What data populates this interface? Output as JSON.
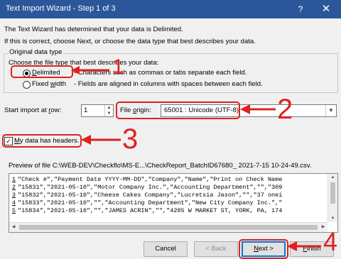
{
  "window": {
    "title": "Text Import Wizard - Step 1 of 3",
    "help_glyph": "?",
    "close_glyph": "✕"
  },
  "intro": {
    "line1": "The Text Wizard has determined that your data is Delimited.",
    "line2": "If this is correct, choose Next, or choose the data type that best describes your data."
  },
  "original_data_type": {
    "legend": "Original data type",
    "prompt": "Choose the file type that best describes your data:",
    "options": [
      {
        "label_prefix": "",
        "label_accel": "D",
        "label_rest": "elimited",
        "desc": "- Characters such as commas or tabs separate each field.",
        "selected": true
      },
      {
        "label_prefix": "Fixed ",
        "label_accel": "w",
        "label_rest": "idth",
        "desc": "- Fields are aligned in columns with spaces between each field.",
        "selected": false
      }
    ]
  },
  "start_import": {
    "label_prefix": "Start import at ",
    "label_accel": "r",
    "label_rest": "ow:",
    "value": "1"
  },
  "file_origin": {
    "label_prefix": "File ",
    "label_accel": "o",
    "label_rest": "rigin:",
    "value": "65001 : Unicode (UTF-8)"
  },
  "headers_checkbox": {
    "label_accel": "M",
    "label_rest": "y data has headers.",
    "checked": true
  },
  "preview": {
    "label": "Preview of file C:\\WEB-DEV\\Checkflo\\MS-E...\\CheckReport_BatchID67680_ 2021-7-15 10-24-49.csv.",
    "rows": [
      {
        "num": "1",
        "text": "\"Check #\",\"Payment Date YYYY-MM-DD\",\"Company\",\"Name\",\"Print on Check Name"
      },
      {
        "num": "2",
        "text": "\"15831\",\"2021-05-10\",\"Motor Company Inc.\",\"Accounting Department\",\"\",\"309"
      },
      {
        "num": "3",
        "text": "\"15832\",\"2021-05-10\",\"Cheese Cakes Company\",\"Lucretsia Jason\",\"\",\"37 onei"
      },
      {
        "num": "4",
        "text": "\"15833\",\"2021-05-10\",\"\",\"Accounting Department\",\"New City Company Inc.\",\""
      },
      {
        "num": "5",
        "text": "\"15834\",\"2021-05-10\",\"\",\"JAMES ACRIN\",\"\",\"4285 W MARKET ST, YORK, PA, 174"
      }
    ]
  },
  "buttons": {
    "cancel": "Cancel",
    "back": "< Back",
    "next_accel": "N",
    "next_rest": "ext >",
    "finish_accel": "F",
    "finish_rest": "inish"
  },
  "annotations": {
    "n1": "1",
    "n2": "2",
    "n3": "3",
    "n4": "4",
    "color": "#e02020"
  },
  "colors": {
    "titlebar": "#2b579a",
    "dialog_bg": "#f0f0f0",
    "default_button_border": "#0078d7"
  }
}
